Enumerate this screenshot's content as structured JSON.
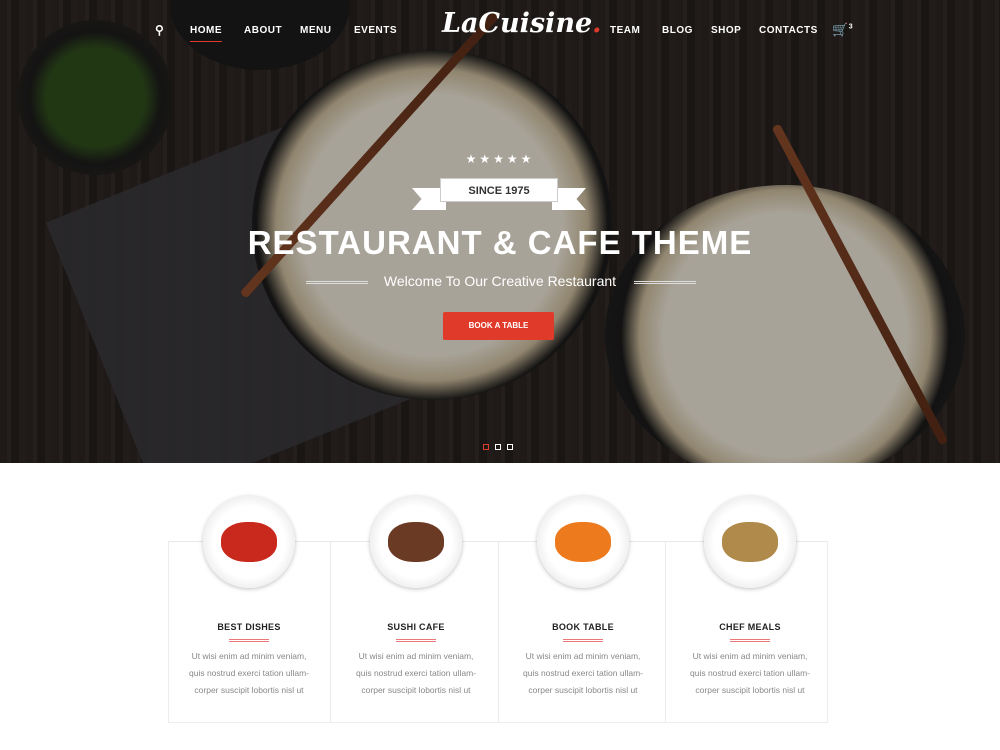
{
  "nav": {
    "left": [
      {
        "label": "HOME",
        "active": true
      },
      {
        "label": "ABOUT"
      },
      {
        "label": "MENU"
      },
      {
        "label": "EVENTS"
      }
    ],
    "right": [
      {
        "label": "TEAM"
      },
      {
        "label": "BLOG"
      },
      {
        "label": "SHOP"
      },
      {
        "label": "CONTACTS"
      }
    ],
    "search_icon": "search-icon",
    "cart_icon": "cart-icon",
    "cart_count": "3"
  },
  "logo": {
    "text": "LaCuisine",
    "dot": "."
  },
  "hero": {
    "stars": "★★★★★",
    "ribbon": "SINCE 1975",
    "title": "RESTAURANT & CAFE THEME",
    "subtitle": "Welcome To Our Creative Restaurant",
    "button": "BOOK A TABLE",
    "slides": 3,
    "active_slide": 1
  },
  "colors": {
    "accent": "#e03a2a"
  },
  "features": [
    {
      "title": "BEST DISHES",
      "text": "Ut wisi enim ad minim veniam, quis nostrud exerci tation ullam-corper suscipit lobortis nisl ut",
      "food": "tomatoes",
      "color": "#c9281c"
    },
    {
      "title": "SUSHI CAFE",
      "text": "Ut wisi enim ad minim veniam, quis nostrud exerci tation ullam-corper suscipit lobortis nisl ut",
      "food": "steak",
      "color": "#6b3a24"
    },
    {
      "title": "BOOK TABLE",
      "text": "Ut wisi enim ad minim veniam, quis nostrud exerci tation ullam-corper suscipit lobortis nisl ut",
      "food": "carrots",
      "color": "#ee7a1e"
    },
    {
      "title": "CHEF MEALS",
      "text": "Ut wisi enim ad minim veniam, quis nostrud exerci tation ullam-corper suscipit lobortis nisl ut",
      "food": "fish",
      "color": "#b08a4a"
    }
  ]
}
